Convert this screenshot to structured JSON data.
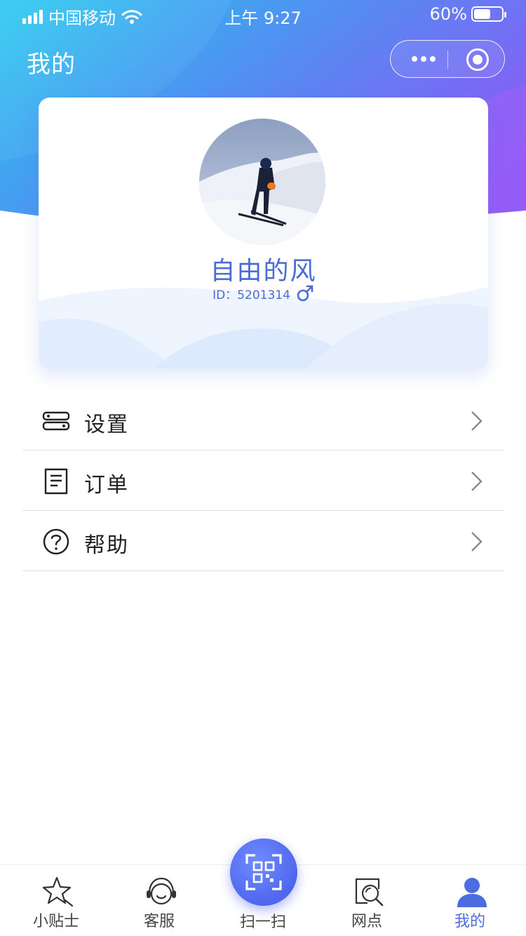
{
  "status_bar": {
    "carrier": "中国移动",
    "time": "上午 9:27",
    "battery_text": "60%",
    "battery_level": 0.6
  },
  "nav": {
    "title": "我的"
  },
  "profile": {
    "nickname": "自由的风",
    "id_text": "ID：5201314",
    "gender_icon": "male-symbol-icon"
  },
  "menu": {
    "items": [
      {
        "label": "设置",
        "icon": "settings-icon"
      },
      {
        "label": "订单",
        "icon": "order-document-icon"
      },
      {
        "label": "帮助",
        "icon": "help-circle-icon"
      }
    ]
  },
  "tabbar": {
    "items": [
      {
        "label": "小贴士",
        "icon": "star-tips-icon"
      },
      {
        "label": "客服",
        "icon": "headset-icon"
      },
      {
        "label": "扫一扫",
        "icon": "qr-scan-icon"
      },
      {
        "label": "网点",
        "icon": "search-location-icon"
      },
      {
        "label": "我的",
        "icon": "user-icon"
      }
    ],
    "active_index": 4
  },
  "colors": {
    "accent": "#4d6ce0",
    "header_gradient_start": "#27c6f0",
    "header_gradient_end": "#8c5af5"
  }
}
